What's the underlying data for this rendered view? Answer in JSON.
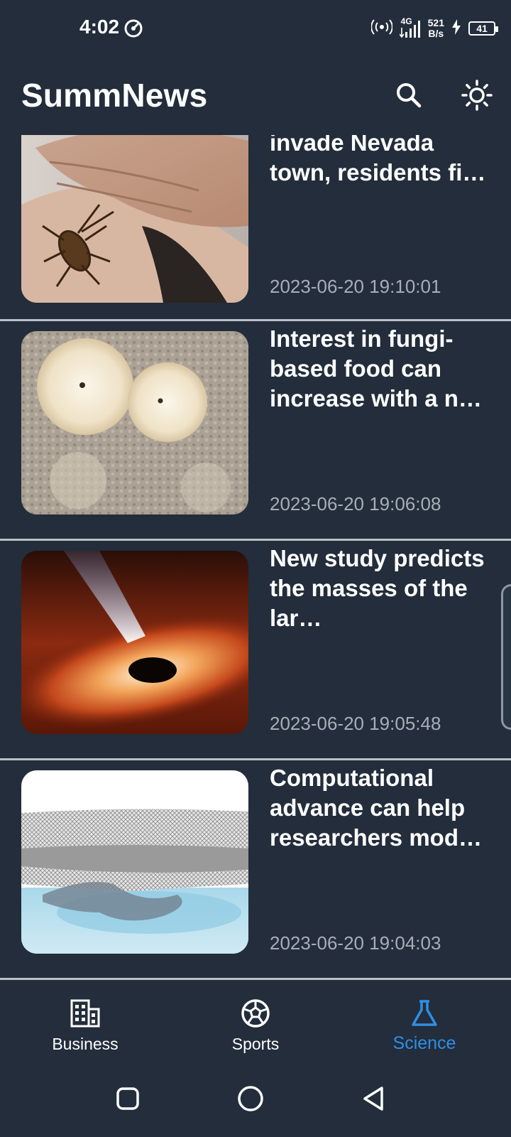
{
  "status_bar": {
    "time": "4:02",
    "network_type": "4G",
    "net_speed_value": "521",
    "net_speed_unit": "B/s",
    "battery_level": "41",
    "icons": [
      "timer-icon",
      "hotspot-icon",
      "signal-icon",
      "charging-icon",
      "battery-icon"
    ]
  },
  "app_bar": {
    "title": "SummNews",
    "actions": [
      "search-icon",
      "brightness-icon"
    ]
  },
  "articles": [
    {
      "title": "Blood-red crickets invade Nevada town, residents fi…",
      "timestamp": "2023-06-20 19:10:01",
      "thumbnail": "cricket-on-skin"
    },
    {
      "title": "Interest in fungi-based food can increase with a n…",
      "timestamp": "2023-06-20 19:06:08",
      "thumbnail": "fungi-colonies"
    },
    {
      "title": "New study predicts the masses of the lar…",
      "timestamp": "2023-06-20 19:05:48",
      "thumbnail": "black-hole"
    },
    {
      "title": "Computational advance can help researchers mod…",
      "timestamp": "2023-06-20 19:04:03",
      "thumbnail": "ice-shelf-model"
    }
  ],
  "bottom_nav": {
    "items": [
      {
        "label": "Business",
        "icon": "building-icon",
        "active": false
      },
      {
        "label": "Sports",
        "icon": "soccer-ball-icon",
        "active": false
      },
      {
        "label": "Science",
        "icon": "flask-icon",
        "active": true
      }
    ],
    "active_color": "#2f8ee6"
  },
  "system_nav": [
    "recents-icon",
    "home-icon",
    "back-icon"
  ],
  "colors": {
    "background": "#232d3b",
    "text": "#ffffff",
    "timestamp": "#a7aeb8",
    "divider": "#b9bfc6"
  }
}
